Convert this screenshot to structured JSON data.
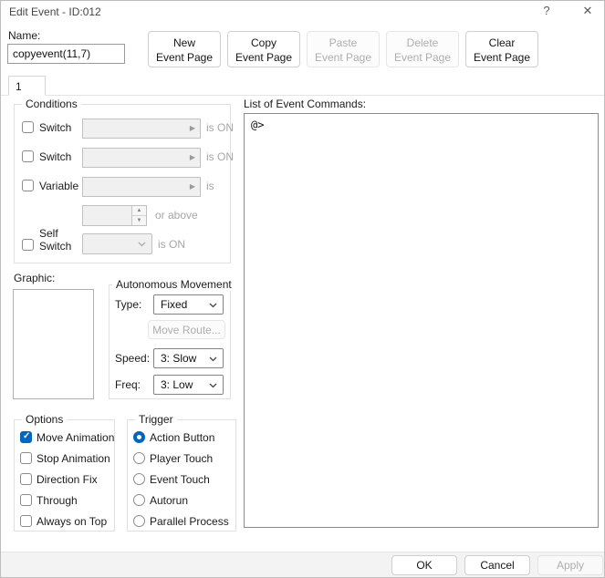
{
  "window": {
    "title": "Edit Event - ID:012",
    "help_icon": "?",
    "close_icon": "✕"
  },
  "name_field": {
    "label": "Name:",
    "value": "copyevent(11,7)"
  },
  "page_buttons": [
    {
      "line1": "New",
      "line2": "Event Page",
      "disabled": false
    },
    {
      "line1": "Copy",
      "line2": "Event Page",
      "disabled": false
    },
    {
      "line1": "Paste",
      "line2": "Event Page",
      "disabled": true
    },
    {
      "line1": "Delete",
      "line2": "Event Page",
      "disabled": true
    },
    {
      "line1": "Clear",
      "line2": "Event Page",
      "disabled": false
    }
  ],
  "tab": {
    "label": "1"
  },
  "conditions": {
    "title": "Conditions",
    "switch1": {
      "label": "Switch",
      "suffix": "is ON",
      "checked": false
    },
    "switch2": {
      "label": "Switch",
      "suffix": "is ON",
      "checked": false
    },
    "variable": {
      "label": "Variable",
      "suffix": "is",
      "checked": false
    },
    "variable_value": {
      "suffix": "or above"
    },
    "self_switch": {
      "label_line1": "Self",
      "label_line2": "Switch",
      "suffix": "is ON",
      "checked": false
    }
  },
  "graphic": {
    "label": "Graphic:"
  },
  "movement": {
    "title": "Autonomous Movement",
    "type_label": "Type:",
    "type_value": "Fixed",
    "move_route_button": "Move Route...",
    "speed_label": "Speed:",
    "speed_value": "3: Slow",
    "freq_label": "Freq:",
    "freq_value": "3: Low"
  },
  "options": {
    "title": "Options",
    "items": [
      {
        "label": "Move Animation",
        "checked": true
      },
      {
        "label": "Stop Animation",
        "checked": false
      },
      {
        "label": "Direction Fix",
        "checked": false
      },
      {
        "label": "Through",
        "checked": false
      },
      {
        "label": "Always on Top",
        "checked": false
      }
    ]
  },
  "trigger": {
    "title": "Trigger",
    "items": [
      {
        "label": "Action Button",
        "selected": true
      },
      {
        "label": "Player Touch",
        "selected": false
      },
      {
        "label": "Event Touch",
        "selected": false
      },
      {
        "label": "Autorun",
        "selected": false
      },
      {
        "label": "Parallel Process",
        "selected": false
      }
    ]
  },
  "commands": {
    "label": "List of Event Commands:",
    "lines": [
      "@>"
    ]
  },
  "footer": {
    "ok": "OK",
    "cancel": "Cancel",
    "apply": "Apply",
    "apply_disabled": true
  },
  "colors": {
    "accent": "#0067c0"
  }
}
